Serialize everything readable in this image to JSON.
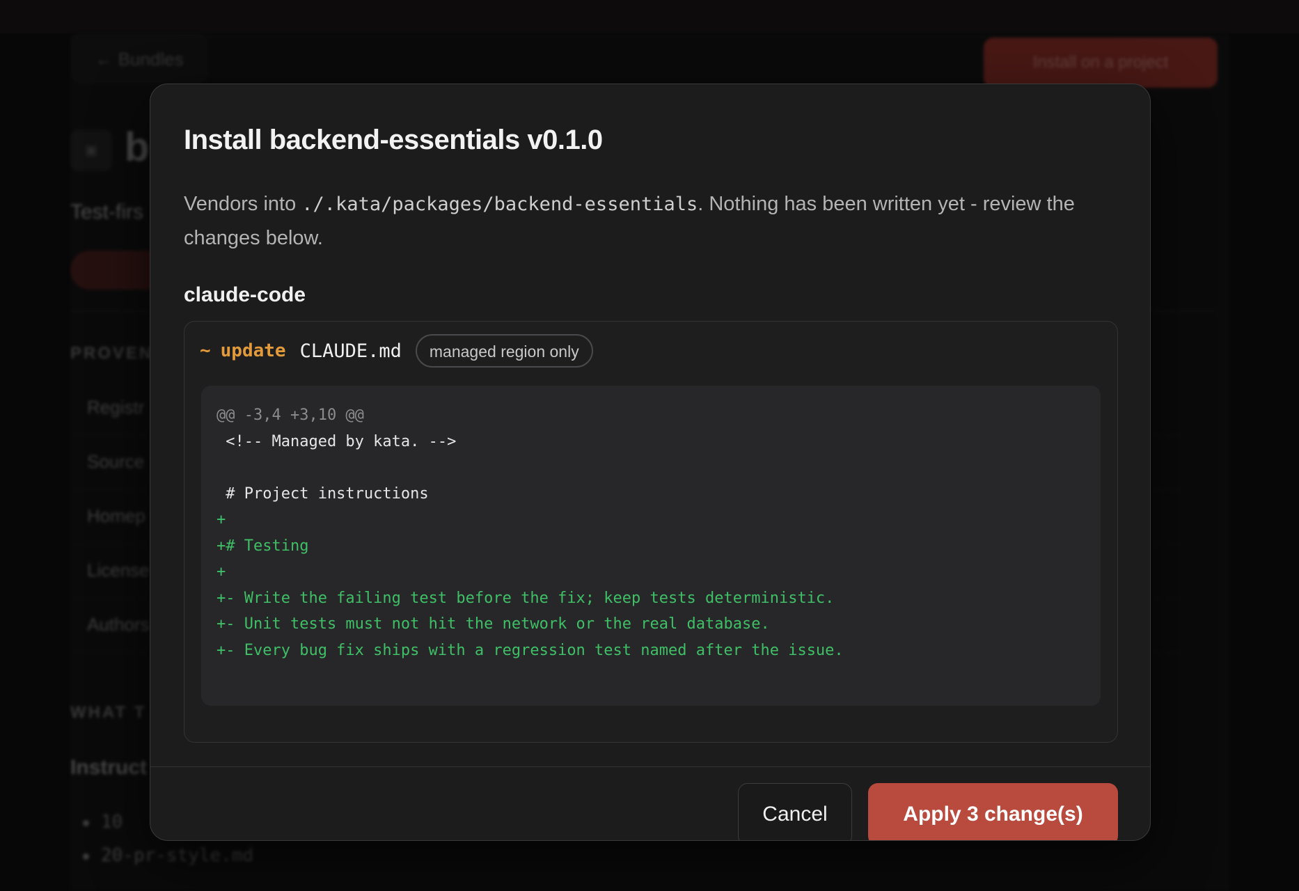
{
  "background": {
    "back_label": "← Bundles",
    "install_label": "Install on a project",
    "title_initial": "b",
    "subtitle": "Test-firs",
    "provenance_heading": "PROVEN",
    "rows": [
      "Registr",
      "Source",
      "Homep",
      "License",
      "Authors"
    ],
    "what_heading": "WHAT T",
    "instructions_heading": "Instruct",
    "list_items": [
      "10",
      "20-pr-style.md"
    ]
  },
  "modal": {
    "title": "Install backend-essentials v0.1.0",
    "description_prefix": "Vendors into ",
    "description_path": "./.kata/packages/backend-essentials",
    "description_suffix": ". Nothing has been written yet - review the changes below.",
    "target_name": "claude-code",
    "change": {
      "marker": "~",
      "operation": "update",
      "file": "CLAUDE.md",
      "badge": "managed region only",
      "diff": [
        {
          "kind": "hunk",
          "text": "@@ -3,4 +3,10 @@"
        },
        {
          "kind": "ctx",
          "text": " <!-- Managed by kata. -->"
        },
        {
          "kind": "ctx",
          "text": " "
        },
        {
          "kind": "ctx",
          "text": " # Project instructions"
        },
        {
          "kind": "add",
          "text": "+"
        },
        {
          "kind": "add",
          "text": "+# Testing"
        },
        {
          "kind": "add",
          "text": "+"
        },
        {
          "kind": "add",
          "text": "+- Write the failing test before the fix; keep tests deterministic."
        },
        {
          "kind": "add",
          "text": "+- Unit tests must not hit the network or the real database."
        },
        {
          "kind": "add",
          "text": "+- Every bug fix ships with a regression test named after the issue."
        }
      ]
    },
    "cancel_label": "Cancel",
    "apply_label": "Apply 3 change(s)"
  },
  "colors": {
    "accent": "#b94a3e",
    "update_marker": "#e39a3b",
    "diff_add": "#3fbf66"
  }
}
